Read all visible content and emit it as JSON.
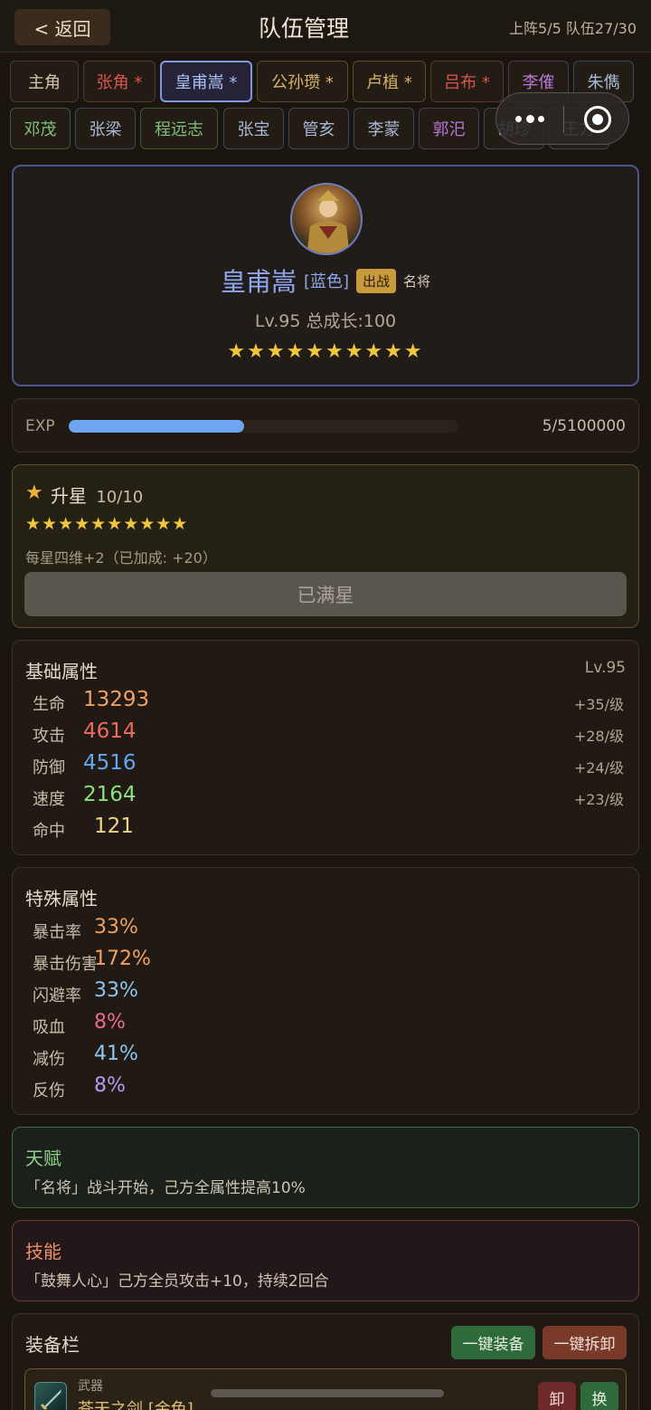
{
  "header": {
    "back_label": "< 返回",
    "title": "队伍管理",
    "stats": "上阵5/5 队伍27/30"
  },
  "tabs_row1": [
    "主角",
    "张角 *",
    "皇甫嵩 *",
    "公孙瓒 *",
    "卢植 *",
    "吕布 *",
    "李傕",
    "朱儁"
  ],
  "tabs_row2": [
    "邓茂",
    "张梁",
    "程远志",
    "张宝",
    "管亥",
    "李蒙",
    "郭汜",
    "胡珍",
    "王方"
  ],
  "selected_tab": "皇甫嵩 *",
  "hero": {
    "name": "皇甫嵩",
    "quality": "[蓝色]",
    "badge": "出战",
    "title": "名将",
    "level_line": "Lv.95  总成长:100",
    "stars": "★★★★★★★★★★"
  },
  "exp": {
    "label": "EXP",
    "value": "5/5100000",
    "progress": 0.45
  },
  "star_up": {
    "icon": "star-icon",
    "title": "升星",
    "count": "10/10",
    "stars": "★★★★★★★★★★",
    "desc": "每星四维+2（已加成: +20）",
    "button": "已满星"
  },
  "base_attrs": {
    "title": "基础属性",
    "level": "Lv.95",
    "rows": [
      {
        "label": "生命",
        "value": "13293",
        "inc": "+35/级"
      },
      {
        "label": "攻击",
        "value": "4614",
        "inc": "+28/级"
      },
      {
        "label": "防御",
        "value": "4516",
        "inc": "+24/级"
      },
      {
        "label": "速度",
        "value": "2164",
        "inc": "+23/级"
      },
      {
        "label": "命中",
        "value": "121",
        "inc": ""
      }
    ]
  },
  "special_attrs": {
    "title": "特殊属性",
    "rows": [
      {
        "label": "暴击率",
        "value": "33%"
      },
      {
        "label": "暴击伤害",
        "value": "172%"
      },
      {
        "label": "闪避率",
        "value": "33%"
      },
      {
        "label": "吸血",
        "value": "8%"
      },
      {
        "label": "减伤",
        "value": "41%"
      },
      {
        "label": "反伤",
        "value": "8%"
      }
    ]
  },
  "talent": {
    "title": "天赋",
    "text": "「名将」战斗开始，己方全属性提高10%"
  },
  "skill": {
    "title": "技能",
    "text": "「鼓舞人心」己方全员攻击+10，持续2回合"
  },
  "equipment": {
    "title": "装备栏",
    "equip_all": "一键装备",
    "remove_all": "一键拆卸",
    "slot": {
      "type": "武器",
      "name": "苍天之剑 [金色]",
      "unequip": "卸",
      "swap": "换"
    }
  },
  "colors": {
    "accent_blue": "#8fa7ee",
    "gold": "#f0c63a",
    "hp": "#f0a060",
    "atk": "#ec6a5e",
    "def": "#62a8f0",
    "spd": "#8be27a",
    "hit": "#f3d38a"
  }
}
